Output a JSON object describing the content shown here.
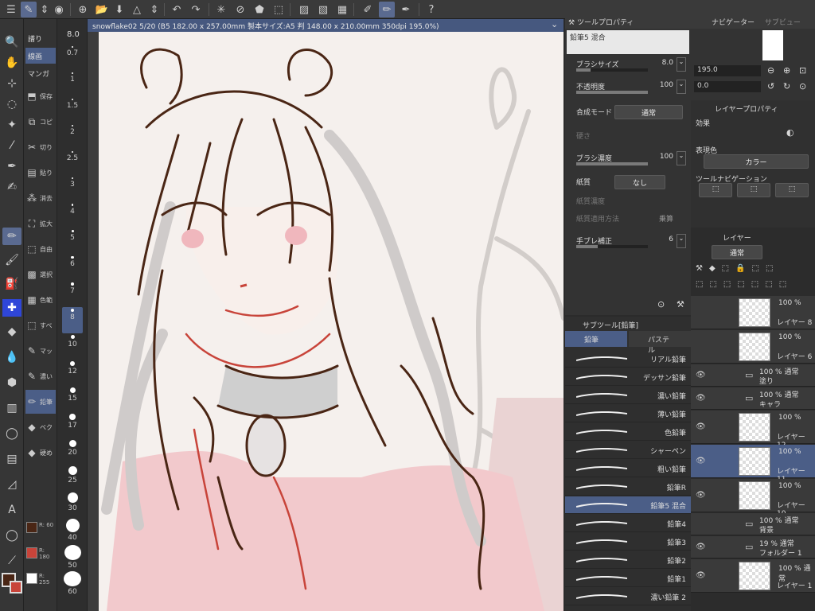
{
  "canvas_tab": {
    "title": "snowflake02 5/20 (B5 182.00 x 257.00mm 製本サイズ:A5 判 148.00 x 210.00mm 350dpi 195.0%)"
  },
  "subtool_tabs": [
    "譜り",
    "線画",
    "マンガ"
  ],
  "subtool_items": [
    "保存",
    "コピ",
    "切り",
    "貼り",
    "消去",
    "拡大",
    "自由",
    "選択",
    "色範",
    "すべ",
    "マッ",
    "濃い",
    "鉛筆",
    "ベク",
    "硬め"
  ],
  "colors": {
    "main": {
      "hex": "#4a2615",
      "label": "R: 60"
    },
    "sub": {
      "hex": "#c8443a",
      "label": "R: 180"
    },
    "white": {
      "hex": "#ffffff",
      "label": "R: 255"
    }
  },
  "brush_sizes": {
    "current": "8.0",
    "items": [
      "0.7",
      "1",
      "1.5",
      "2",
      "2.5",
      "3",
      "4",
      "5",
      "6",
      "7",
      "8",
      "10",
      "12",
      "15",
      "17",
      "20",
      "25",
      "30",
      "40",
      "50",
      "60"
    ],
    "active": "8"
  },
  "tool_property": {
    "title": "ツールプロパティ",
    "brush_name": "鉛筆5 混合",
    "brush_size_label": "ブラシサイズ",
    "brush_size_value": "8.0",
    "opacity_label": "不透明度",
    "opacity_value": "100",
    "blend_label": "合成モード",
    "blend_value": "通常",
    "hardness_label": "硬さ",
    "density_label": "ブラシ濃度",
    "density_value": "100",
    "paper_label": "紙質",
    "paper_value": "なし",
    "paper_density_label": "紙質濃度",
    "paper_method_label": "紙質適用方法",
    "paper_method_value": "乗算",
    "stabilization_label": "手ブレ補正",
    "stabilization_value": "6"
  },
  "sub_tool": {
    "title": "サブツール[鉛筆]",
    "tab_pencil": "鉛筆",
    "tab_pastel": "パステル",
    "brushes": [
      "リアル鉛筆",
      "デッサン鉛筆",
      "濃い鉛筆",
      "薄い鉛筆",
      "色鉛筆",
      "シャーペン",
      "粗い鉛筆",
      "鉛筆R",
      "鉛筆5 混合",
      "鉛筆4",
      "鉛筆3",
      "鉛筆2",
      "鉛筆1",
      "濃い鉛筆 2"
    ],
    "active": "鉛筆5 混合"
  },
  "navigator": {
    "title": "ナビゲーター",
    "tab2": "サブビュー",
    "zoom": "195.0",
    "rotation": "0.0"
  },
  "layer_property": {
    "title": "レイヤープロパティ",
    "effect_label": "効果",
    "expression_label": "表現色",
    "expression_value": "カラー",
    "toolnav_label": "ツールナビゲーション"
  },
  "layers": {
    "title": "レイヤー",
    "blend": "通常",
    "items": [
      {
        "type": "layer",
        "percent": "100 %",
        "name": "レイヤー 8",
        "visible": false
      },
      {
        "type": "layer",
        "percent": "100 %",
        "name": "レイヤー 6",
        "visible": false
      },
      {
        "type": "folder",
        "percent": "100 % 通常",
        "name": "塗り",
        "visible": true
      },
      {
        "type": "folder",
        "percent": "100 % 通常",
        "name": "キャラ",
        "visible": true
      },
      {
        "type": "layer",
        "percent": "100 %",
        "name": "レイヤー 12",
        "visible": true
      },
      {
        "type": "layer",
        "percent": "100 %",
        "name": "レイヤー 11",
        "visible": true,
        "selected": true
      },
      {
        "type": "layer",
        "percent": "100 %",
        "name": "レイヤー 10",
        "visible": true
      },
      {
        "type": "folder",
        "percent": "100 % 通常",
        "name": "背景",
        "visible": false
      },
      {
        "type": "folder",
        "percent": "19 % 通常",
        "name": "フォルダー 1",
        "visible": true
      },
      {
        "type": "layer",
        "percent": "100 % 通常",
        "name": "レイヤー 1",
        "visible": true
      }
    ]
  }
}
